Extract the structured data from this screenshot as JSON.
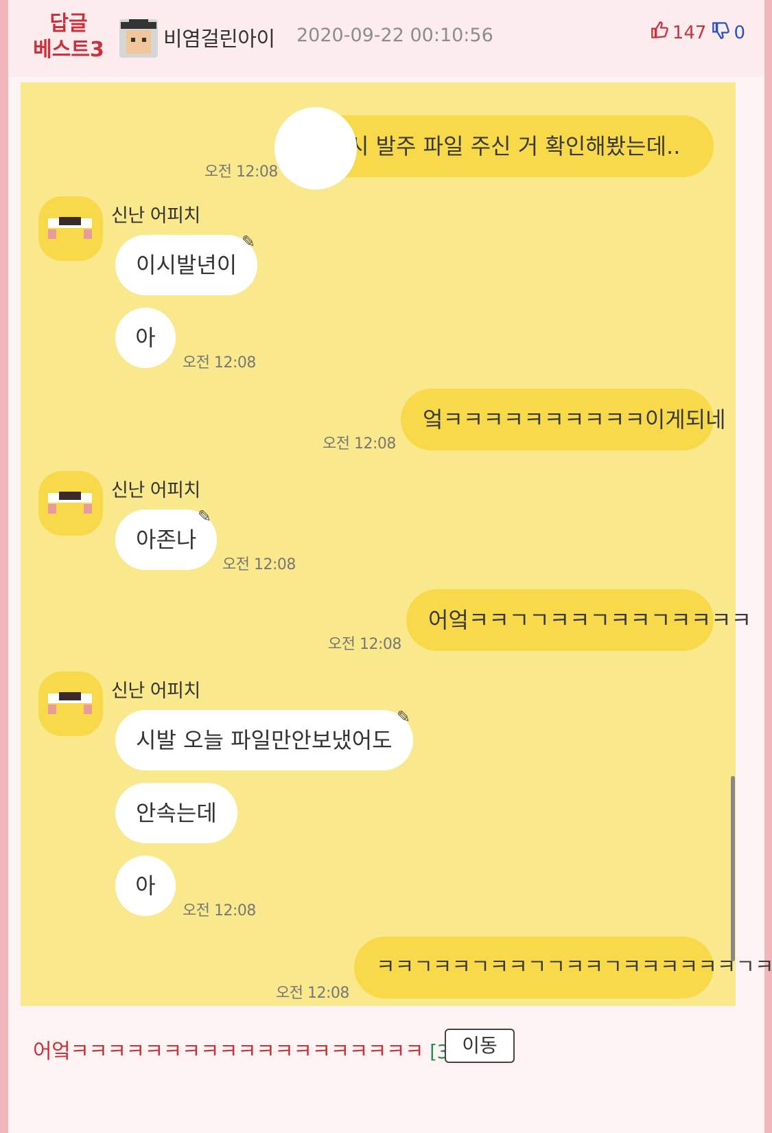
{
  "header": {
    "best_line1": "답글",
    "best_line2": "베스트3",
    "username": "비염걸린아이",
    "timestamp": "2020-09-22 00:10:56",
    "upvotes": "147",
    "downvotes": "0",
    "upvote_icon": "thumbs-up-icon",
    "downvote_icon": "thumbs-down-icon"
  },
  "chat": {
    "sender": "신난 어피치",
    "messages": [
      {
        "side": "me",
        "text": "시 발주 파일 주신 거 확인해봤는데..",
        "time": "오전 12:08"
      },
      {
        "side": "other",
        "text": "이시발년이"
      },
      {
        "side": "other",
        "text": "아",
        "time": "오전 12:08"
      },
      {
        "side": "me",
        "text": "엌ㅋㅋㅋㅋㅋㅋㅋㅋㅋㅋ이게되네",
        "time": "오전 12:08"
      },
      {
        "side": "other",
        "text": "아존나",
        "time": "오전 12:08"
      },
      {
        "side": "me",
        "text": "어엌ㅋㅋㄱㄱㅋㅋㄱㅋㅋㄱㅋㅋㅋㅋ",
        "time": "오전 12:08"
      },
      {
        "side": "other",
        "text": "시발 오늘 파일만안보냈어도"
      },
      {
        "side": "other",
        "text": "안속는데"
      },
      {
        "side": "other",
        "text": "아",
        "time": "오전 12:08"
      },
      {
        "side": "me",
        "text": "ㅋㅋㄱㅋㅋㄱㅋㅋㄱㄱㅋㅋㄱㅋㅋㅋㅋㅋㅋㄱㅋ",
        "time": "오전 12:08"
      }
    ]
  },
  "footer": {
    "reply_text": "어엌ㅋㅋㅋㅋㅋㅋㅋㅋㅋㅋㅋㅋㅋㅋㅋㅋㅋㅋㅋ",
    "reply_count": "[3]",
    "move_label": "이동"
  },
  "colors": {
    "chat_background": "#f9e88c",
    "my_bubble": "#f7d94a",
    "other_bubble": "#ffffff",
    "accent_red": "#c8323c"
  }
}
